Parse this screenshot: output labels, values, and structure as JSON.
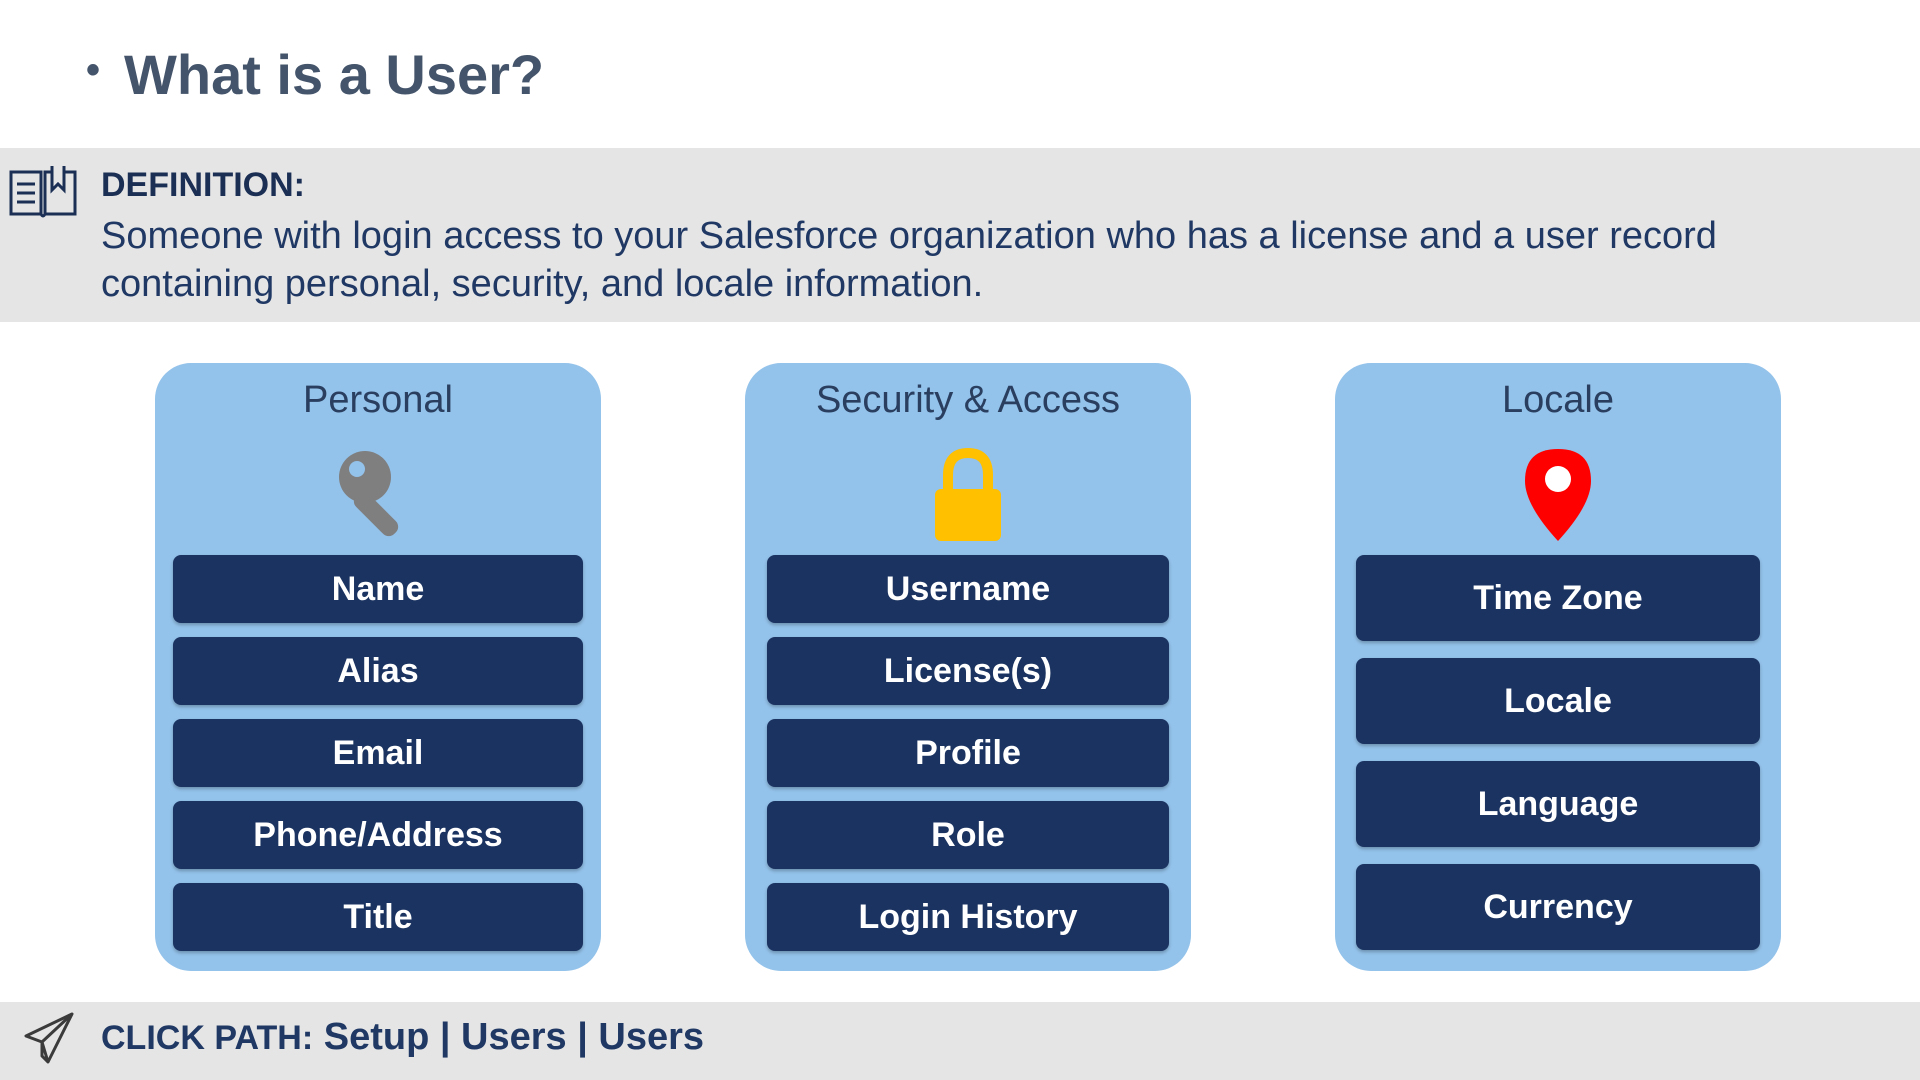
{
  "title": "What is a User?",
  "definition": {
    "label": "DEFINITION:",
    "text": "Someone with login access to your Salesforce organization who has a license and a user record containing personal, security, and locale information.",
    "icon": "book-icon"
  },
  "cards": [
    {
      "title": "Personal",
      "icon": "key-icon",
      "icon_color": "#7f7f7f",
      "items": [
        "Name",
        "Alias",
        "Email",
        "Phone/Address",
        "Title"
      ]
    },
    {
      "title": "Security & Access",
      "icon": "padlock-icon",
      "icon_color": "#ffc000",
      "items": [
        "Username",
        "License(s)",
        "Profile",
        "Role",
        "Login History"
      ]
    },
    {
      "title": "Locale",
      "icon": "map-pin-icon",
      "icon_color": "#ff0000",
      "items": [
        "Time Zone",
        "Locale",
        "Language",
        "Currency"
      ]
    }
  ],
  "footer": {
    "label": "CLICK PATH:",
    "path": "Setup | Users | Users",
    "icon": "paper-plane-icon"
  },
  "colors": {
    "card_bg": "#93c2ea",
    "item_bg": "#1b3360",
    "band_bg": "#e5e5e5",
    "title_text": "#44546a"
  }
}
